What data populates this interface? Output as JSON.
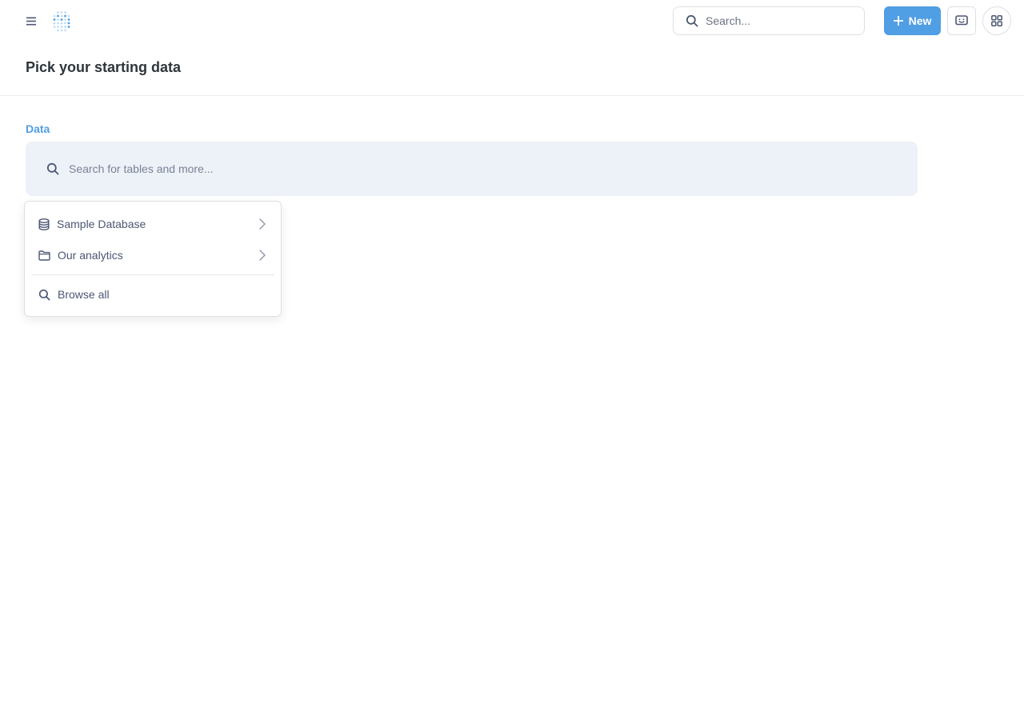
{
  "nav": {
    "search_placeholder": "Search...",
    "new_label": "New"
  },
  "page": {
    "title": "Pick your starting data"
  },
  "data_section": {
    "label": "Data",
    "search_placeholder": "Search for tables and more..."
  },
  "dropdown": {
    "items": [
      {
        "label": "Sample Database",
        "icon": "database-icon",
        "has_submenu": true
      },
      {
        "label": "Our analytics",
        "icon": "folder-icon",
        "has_submenu": true
      },
      {
        "label": "Browse all",
        "icon": "search-icon",
        "has_submenu": false
      }
    ]
  },
  "colors": {
    "brand": "#509ee3",
    "text": "#4c5773",
    "search_bg": "#edf2f8"
  }
}
